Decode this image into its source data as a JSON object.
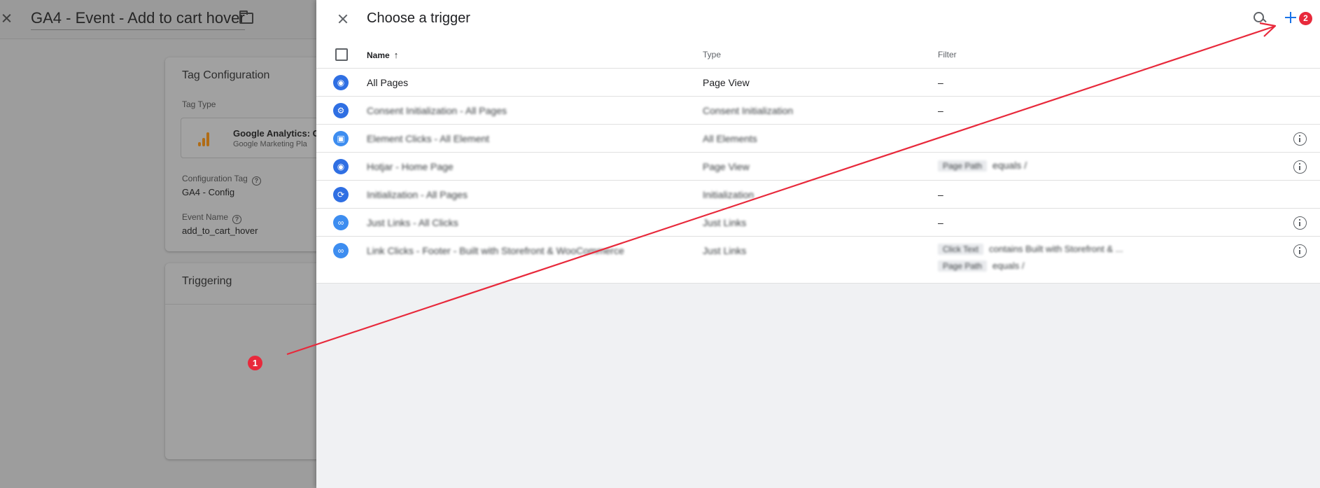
{
  "background": {
    "title": "GA4 - Event - Add to cart hover",
    "tag_configuration": {
      "heading": "Tag Configuration",
      "tag_type_label": "Tag Type",
      "tag_type_name": "Google Analytics: G",
      "tag_type_sub": "Google Marketing Pla",
      "config_tag_label": "Configuration Tag",
      "config_tag_value": "GA4 - Config",
      "event_name_label": "Event Name",
      "event_name_value": "add_to_cart_hover"
    },
    "triggering": {
      "heading": "Triggering"
    }
  },
  "panel": {
    "title": "Choose a trigger",
    "columns": {
      "name": "Name",
      "type": "Type",
      "filter": "Filter"
    },
    "rows": [
      {
        "name": "All Pages",
        "type": "Page View",
        "filter": "–",
        "icon": "eye-icon",
        "info": false
      },
      {
        "name": "Consent Initialization - All Pages",
        "type": "Consent Initialization",
        "filter": "–",
        "icon": "consent-icon",
        "info": false
      },
      {
        "name": "Element Clicks - All Element",
        "type": "All Elements",
        "filter": "",
        "icon": "click-icon",
        "info": true
      },
      {
        "name": "Hotjar - Home Page",
        "type": "Page View",
        "filter_chip": "Page Path",
        "filter_text": "equals /",
        "icon": "eye-icon",
        "info": true
      },
      {
        "name": "Initialization - All Pages",
        "type": "Initialization",
        "filter": "–",
        "icon": "init-icon",
        "info": false
      },
      {
        "name": "Just Links - All Clicks",
        "type": "Just Links",
        "filter": "–",
        "icon": "link-icon",
        "info": true
      },
      {
        "name": "Link Clicks - Footer - Built with Storefront & WooCommerce",
        "type": "Just Links",
        "filter_chip": "Click Text",
        "filter_text": "contains Built with Storefront & ...",
        "filter_chip_2": "Page Path",
        "filter_text_2": "equals /",
        "icon": "link-icon",
        "info": true
      }
    ]
  },
  "annotations": {
    "badge_1": "1",
    "badge_2": "2",
    "arrow_color": "#e8293b"
  },
  "colors": {
    "accent": "#1a73e8",
    "trigger_icon": "#2f6fe3",
    "annotation": "#e8293b"
  }
}
